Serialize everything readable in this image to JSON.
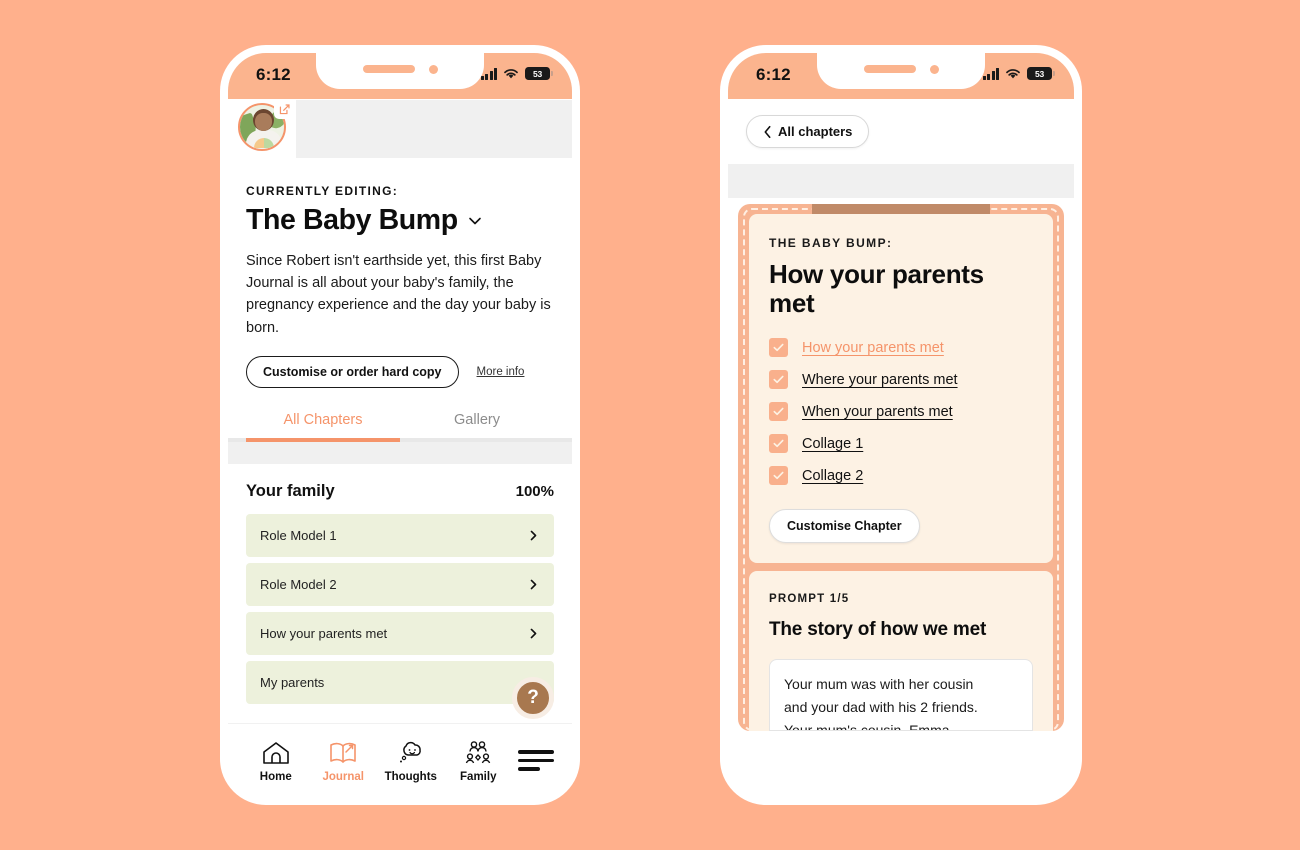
{
  "theme": {
    "page_bg": "#FFB08C",
    "accent": "#F5946A",
    "peach": "#FBB48E",
    "card_cream": "#FDF2E4",
    "list_green": "#EDF1DC",
    "help_brown": "#A8784F",
    "book_tab": "#C08A68"
  },
  "status_bar": {
    "time": "6:12",
    "battery": "53",
    "signal_icon": "cellular-signal-icon",
    "wifi_icon": "wifi-icon",
    "battery_icon": "battery-icon"
  },
  "left_phone": {
    "avatar": {
      "name": "avatar",
      "edit_badge_icon": "edit-pencil-icon"
    },
    "kicker": "CURRENTLY EDITING:",
    "title": "The Baby Bump",
    "title_chevron_icon": "chevron-down-icon",
    "description": "Since Robert isn't earthside yet, this first Baby Journal is all about your baby's family, the pregnancy experience and the day your baby is born.",
    "customise_button": "Customise or order hard copy",
    "more_info_link": "More info",
    "tabs": [
      {
        "label": "All Chapters",
        "active": true
      },
      {
        "label": "Gallery",
        "active": false
      }
    ],
    "section": {
      "title": "Your family",
      "percent": "100%"
    },
    "chapters": [
      {
        "label": "Role Model 1",
        "chevron_icon": "chevron-right-icon"
      },
      {
        "label": "Role Model 2",
        "chevron_icon": "chevron-right-icon"
      },
      {
        "label": "How your parents met",
        "chevron_icon": "chevron-right-icon"
      },
      {
        "label": "My parents",
        "chevron_icon": "chevron-right-icon"
      }
    ],
    "help_button": {
      "label": "?",
      "icon": "question-mark-icon"
    },
    "bottom_nav": [
      {
        "label": "Home",
        "icon": "home-icon",
        "active": false
      },
      {
        "label": "Journal",
        "icon": "book-icon",
        "active": true
      },
      {
        "label": "Thoughts",
        "icon": "thought-bubble-icon",
        "active": false
      },
      {
        "label": "Family",
        "icon": "family-group-icon",
        "active": false
      }
    ],
    "menu_button": {
      "icon": "hamburger-menu-icon"
    }
  },
  "right_phone": {
    "back_button": {
      "label": "All chapters",
      "icon": "chevron-left-icon"
    },
    "card": {
      "kicker": "THE BABY BUMP:",
      "title": "How your parents met",
      "items": [
        {
          "label": "How your parents met",
          "checked": true,
          "current": true
        },
        {
          "label": "Where your parents met",
          "checked": true,
          "current": false
        },
        {
          "label": "When your parents met",
          "checked": true,
          "current": false
        },
        {
          "label": "Collage 1",
          "checked": true,
          "current": false
        },
        {
          "label": "Collage 2",
          "checked": true,
          "current": false
        }
      ],
      "customise_button": "Customise Chapter"
    },
    "prompt": {
      "kicker": "PROMPT 1/5",
      "title": "The story of how we met",
      "text_line_1": "Your mum was with her cousin",
      "text_line_2": "and your dad with his 2 friends.",
      "text_line_3": "Your mum's cousin, Emma,"
    }
  }
}
